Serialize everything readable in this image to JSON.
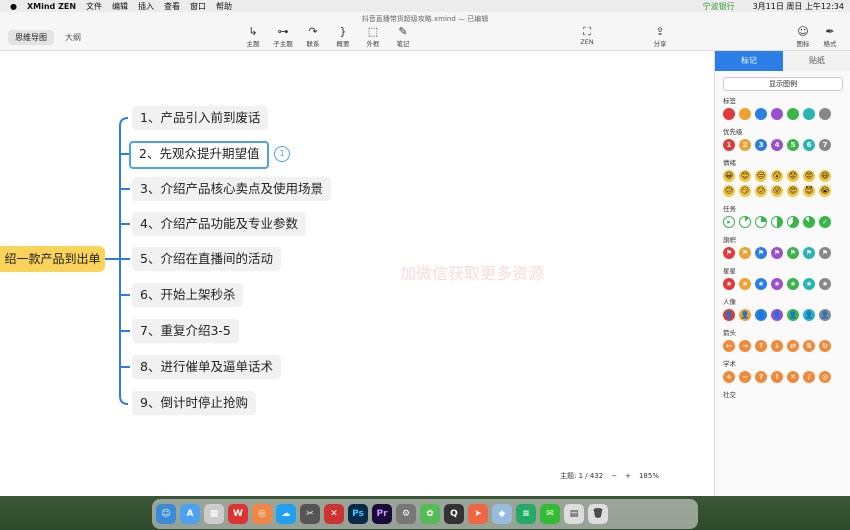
{
  "menubar": {
    "app": "XMind ZEN",
    "items": [
      "文件",
      "编辑",
      "插入",
      "查看",
      "窗口",
      "帮助"
    ],
    "notice": "宁波银行",
    "clock": "3月11日 周日 上午12:34"
  },
  "window": {
    "title": "抖音直播带货超级攻略.xmind — 已编辑",
    "view_tabs": [
      "思维导图",
      "大纲"
    ]
  },
  "toolbar": [
    {
      "label": "主题",
      "icon": "↳"
    },
    {
      "label": "子主题",
      "icon": "⊶"
    },
    {
      "label": "联系",
      "icon": "↷"
    },
    {
      "label": "概要",
      "icon": "}"
    },
    {
      "label": "外框",
      "icon": "⬚"
    },
    {
      "label": "笔记",
      "icon": "✎"
    },
    {
      "label": "ZEN",
      "icon": "⛶"
    },
    {
      "label": "分享",
      "icon": "⇪"
    },
    {
      "label": "图标",
      "icon": "☺"
    },
    {
      "label": "格式",
      "icon": "✒"
    }
  ],
  "mindmap": {
    "root": "绍一款产品到出单",
    "branches": [
      "1、产品引入前到废话",
      "2、先观众提升期望值",
      "3、介绍产品核心卖点及使用场景",
      "4、介绍产品功能及专业参数",
      "5、介绍在直播间的活动",
      "6、开始上架秒杀",
      "7、重复介绍3-5",
      "8、进行催单及逼单话术",
      "9、倒计时停止抢购"
    ],
    "selected_badge": "1"
  },
  "watermark": "加微信获取更多资源",
  "status": {
    "topics": "主题: 1 / 432",
    "zoom": "185%"
  },
  "panel": {
    "tabs": [
      "标记",
      "贴纸"
    ],
    "legend_button": "显示图例",
    "sections": {
      "tag": "标签",
      "priority": "优先级",
      "emotion": "情绪",
      "task": "任务",
      "flag": "旗帜",
      "star": "星星",
      "person": "人像",
      "arrow": "箭头",
      "academic": "学术",
      "social": "社交"
    },
    "priority_numbers": [
      "1",
      "2",
      "3",
      "4",
      "5",
      "6",
      "7"
    ],
    "tag_colors": [
      "#e03a3a",
      "#f0a030",
      "#2a7ee6",
      "#9b4fd0",
      "#3ab54a",
      "#2ab5b5",
      "#888888"
    ]
  }
}
